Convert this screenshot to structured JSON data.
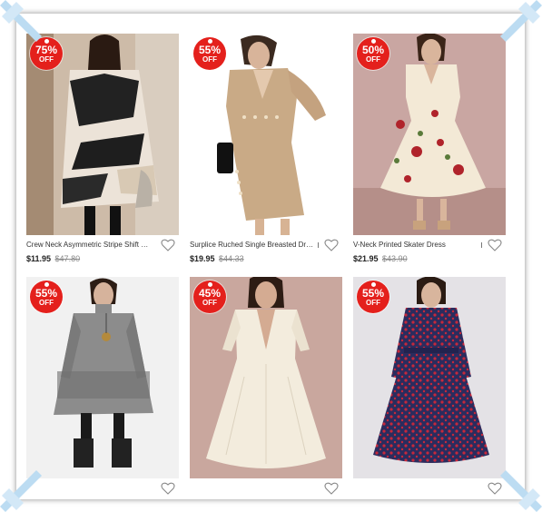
{
  "products": [
    {
      "discount": "75%",
      "off": "OFF",
      "title": "Crew Neck Asymmetric Stripe Shift Dress",
      "price": "$11.95",
      "old_price": "$47.80"
    },
    {
      "discount": "55%",
      "off": "OFF",
      "title": "Surplice Ruched Single Breasted Dress",
      "price": "$19.95",
      "old_price": "$44.33"
    },
    {
      "discount": "50%",
      "off": "OFF",
      "title": "V-Neck Printed Skater Dress",
      "price": "$21.95",
      "old_price": "$43.90"
    },
    {
      "discount": "55%",
      "off": "OFF",
      "title": "",
      "price": "",
      "old_price": ""
    },
    {
      "discount": "45%",
      "off": "OFF",
      "title": "",
      "price": "",
      "old_price": ""
    },
    {
      "discount": "55%",
      "off": "OFF",
      "title": "",
      "price": "",
      "old_price": ""
    }
  ],
  "colors": {
    "badge": "#e4201c",
    "corner_ribbon": "#bcdcf2"
  },
  "icons": {
    "wishlist": "heart-outline-icon",
    "corner": "ribbon-corner-icon"
  }
}
